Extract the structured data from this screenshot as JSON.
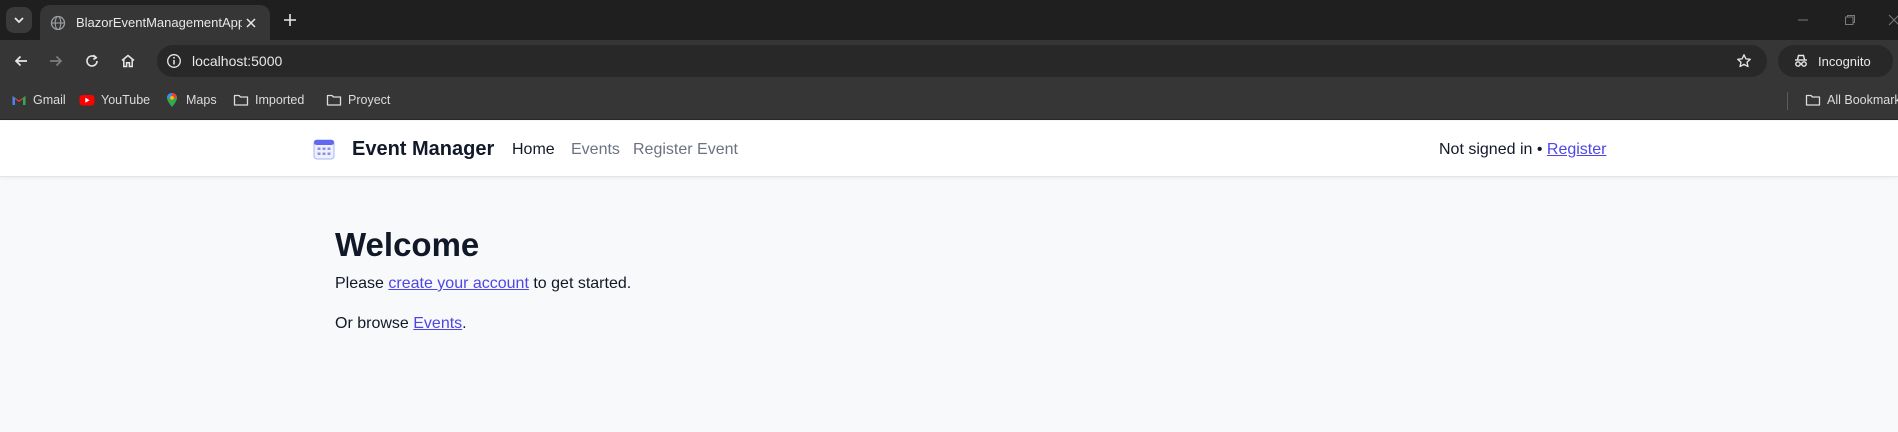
{
  "browser": {
    "tab_title": "BlazorEventManagementApp",
    "url": "localhost:5000",
    "incognito_label": "Incognito",
    "bookmarks": [
      {
        "label": "Gmail",
        "icon": "gmail-icon"
      },
      {
        "label": "YouTube",
        "icon": "youtube-icon"
      },
      {
        "label": "Maps",
        "icon": "maps-icon"
      },
      {
        "label": "Imported",
        "icon": "folder-icon"
      },
      {
        "label": "Proyect",
        "icon": "folder-icon"
      }
    ],
    "all_bookmarks_label": "All Bookmarks"
  },
  "app": {
    "brand": "Event Manager",
    "nav": [
      {
        "label": "Home",
        "active": true
      },
      {
        "label": "Events",
        "active": false
      },
      {
        "label": "Register Event",
        "active": false
      }
    ],
    "auth_status": "Not signed in",
    "auth_separator": " • ",
    "register_link": "Register"
  },
  "main": {
    "heading": "Welcome",
    "line1_prefix": "Please ",
    "line1_link": "create your account",
    "line1_suffix": " to get started.",
    "line2_prefix": "Or browse ",
    "line2_link": "Events",
    "line2_suffix": "."
  },
  "colors": {
    "chrome_dark": "#1f1f1f",
    "chrome_toolbar": "#363636",
    "page_bg": "#f8f9fb",
    "link": "#4f46e5",
    "text": "#111827"
  }
}
